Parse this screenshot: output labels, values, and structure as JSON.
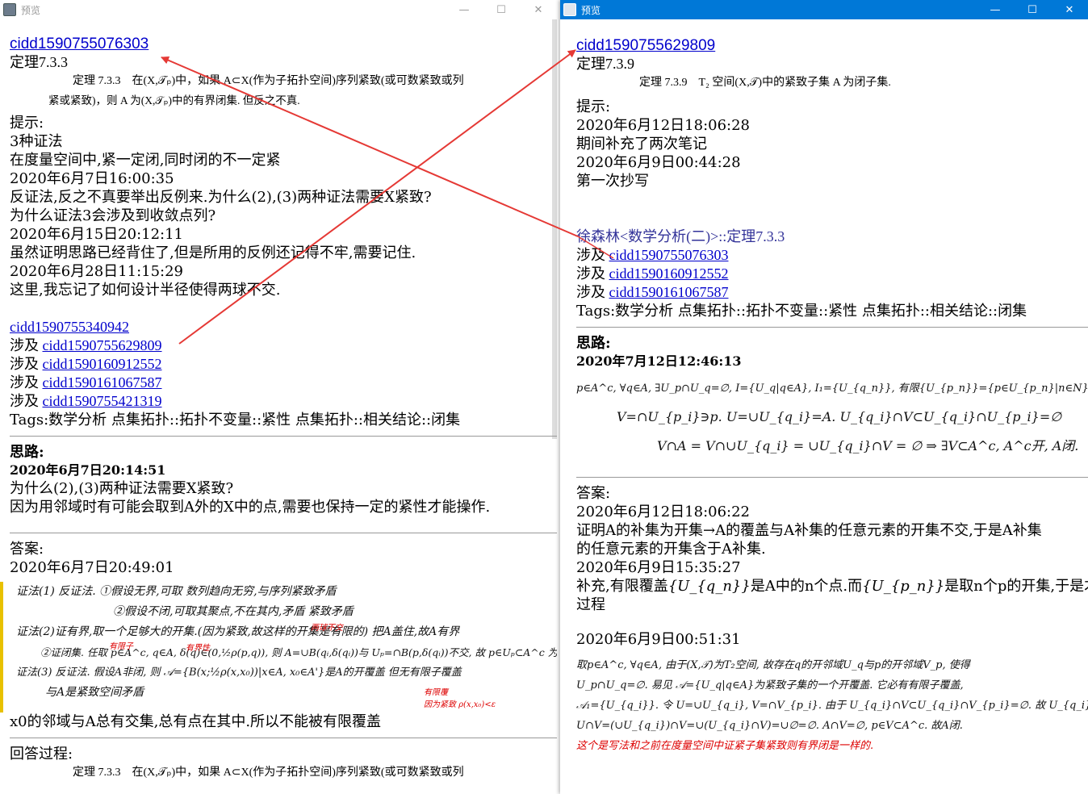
{
  "left_window": {
    "title": "预览",
    "buttons": {
      "minimize": "—",
      "maximize": "☐",
      "close": "✕"
    },
    "card_id": "cidd1590755076303",
    "theorem_name": "定理7.3.3",
    "theorem_text_1": "定理 7.3.3　在(X,𝒯ₚ)中，如果 A⊂X(作为子拓扑空间)序列紧致(或可数紧致或列",
    "theorem_text_2": "紧或紧致)，则 A 为(X,𝒯ₚ)中的有界闭集. 但反之不真.",
    "hint_label": "提示:",
    "hint_lines": [
      "3种证法",
      "在度量空间中,紧一定闭,同时闭的不一定紧",
      "2020年6月7日16:00:35",
      "反证法,反之不真要举出反例来.为什么(2),(3)两种证法需要X紧致?",
      "为什么证法3会涉及到收敛点列?",
      "2020年6月15日20:12:11",
      "虽然证明思路已经背住了,但是所用的反例还记得不牢,需要记住.",
      "2020年6月28日11:15:29",
      "这里,我忘记了如何设计半径使得两球不交."
    ],
    "self_link": "cidd1590755340942",
    "refs_prefix": "涉及",
    "refs": [
      "cidd1590755629809",
      "cidd1590160912552",
      "cidd1590161067587",
      "cidd1590755421319"
    ],
    "tags": "Tags:数学分析 点集拓扑::拓扑不变量::紧性 点集拓扑::相关结论::闭集",
    "thinking_label": "思路:",
    "thinking_time": "2020年6月7日20:14:51",
    "thinking_lines": [
      "为什么(2),(3)两种证法需要X紧致?",
      "因为用邻域时有可能会取到A外的X中的点,需要也保持一定的紧性才能操作."
    ],
    "answer_label": "答案:",
    "answer_time": "2020年6月7日20:49:01",
    "handwriting": [
      "证法(1) 反证法.  ①假设无界,可取 数列趋向无穷,与序列紧致矛盾",
      "②假设不闭,可取其聚点,不在其内,矛盾 紧致矛盾",
      "证法(2)证有界,取一个足够大的开集.(因为紧致,故这样的开集是有限的) 把A盖住,故A有界",
      "②证闭集. 任取 p∈A^c, q∈A, δ(q)∈(0,½ρ(p,q)), 则 A=∪B(qᵢ,δ(qᵢ))与 Uₚ=∩B(p,δ(qᵢ))不交, 故 p∈Uₚ⊂A^c 为闭",
      "证法(3) 反证法. 假设A非闭, 则 𝒜={B(x;½ρ(x,x₀))|x∈A, x₀∈A'}是A的开覆盖  但无有限子覆盖",
      "与A是紧致空间矛盾"
    ],
    "handwriting_red": [
      "有限子",
      "有界性",
      "两球不交",
      "有限覆",
      "因为紧致 ρ(x,x₀)<ε"
    ],
    "answer_after": "x0的邻域与A总有交集,总有点在其中.所以不能被有限覆盖",
    "process_label": "回答过程:",
    "process_preview": "定理 7.3.3　在(X,𝒯ₚ)中，如果 A⊂X(作为子拓扑空间)序列紧致(或可数紧致或列"
  },
  "right_window": {
    "title": "预览",
    "buttons": {
      "minimize": "—",
      "maximize": "☐",
      "close": "✕"
    },
    "card_id": "cidd1590755629809",
    "theorem_name": "定理7.3.9",
    "theorem_text": "定理 7.3.9　T₂ 空间(X,𝒯)中的紧致子集 A 为闭子集.",
    "hint_label": "提示:",
    "hint_lines": [
      "2020年6月12日18:06:28",
      "期间补充了两次笔记",
      "2020年6月9日00:44:28",
      "第一次抄写"
    ],
    "self_link": "徐森林<数学分析(二)>::定理7.3.3",
    "refs_prefix": "涉及",
    "refs": [
      "cidd1590755076303",
      "cidd1590160912552",
      "cidd1590161067587"
    ],
    "tags": "Tags:数学分析 点集拓扑::拓扑不变量::紧性 点集拓扑::相关结论::闭集",
    "thinking_label": "思路:",
    "thinking_time": "2020年7月12日12:46:13",
    "thinking_handwriting": [
      "p∈A^c, ∀q∈A, ∃U_p∩U_q=∅, I={U_q|q∈A}, I₁={U_{q_n}}, 有限{U_{p_n}}={p∈U_{p_n}|n∈N}",
      "V=∩U_{p_i}∋p.  U=∪U_{q_i}=A.  U_{q_i}∩V⊂U_{q_i}∩U_{p_i}=∅",
      "V∩A = V∩∪U_{q_i} = ∪U_{q_i}∩V = ∅ ⇒ ∃V⊂A^c, A^c开, A闭."
    ],
    "answer_label": "答案:",
    "answer_time": "2020年6月12日18:06:22",
    "answer_lines": [
      "证明A的补集为开集→A的覆盖与A补集的任意元素的开集不交,于是A补集",
      "的任意元素的开集含于A补集.",
      "2020年6月9日15:35:27"
    ],
    "supplement_before": "补充,有限覆盖",
    "supplement_mid1": "是A中的n个点.而",
    "supplement_mid2": "是取n个p的开集,于是才有以下",
    "supplement_end": "过程",
    "supplement_math1": "{U_{q_n}}",
    "supplement_math2": "{U_{p_n}}",
    "answer_time2": "2020年6月9日00:51:31",
    "answer_handwriting": [
      "取p∈A^c, ∀q∈A, 由于(X,𝒯)为T₂空间, 故存在q的开邻域U_q与p的开邻域V_p, 使得",
      "U_p∩U_q=∅. 易见 𝒜={U_q|q∈A}为紧致子集的一个开覆盖. 它必有有限子覆盖,",
      "𝒜₁={U_{q_i}}. 令 U=∪U_{q_i}, V=∩V_{p_i}. 由于 U_{q_i}∩V⊂U_{q_i}∩V_{p_i}=∅. 故 U_{q_i}∩V=∅",
      "U∩V=(∪U_{q_i})∩V=∪(U_{q_i}∩V)=∪∅=∅.  A∩V=∅,  p∈V⊂A^c. 故A闭."
    ],
    "answer_handwriting_red": "这个是写法和之前在度量空间中证紧子集紧致则有界闭是一样的."
  },
  "annotation": {
    "arrow_color": "#e53935"
  }
}
